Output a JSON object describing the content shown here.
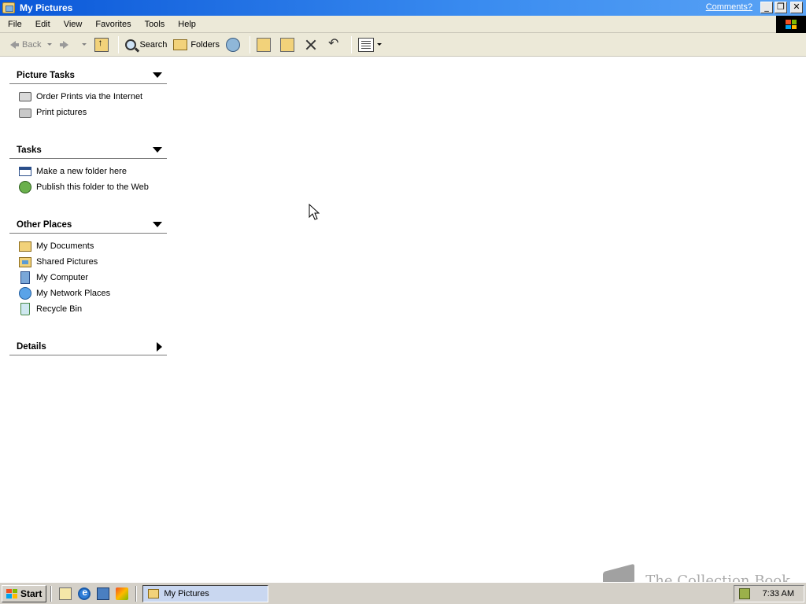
{
  "window": {
    "title": "My Pictures",
    "comments_link": "Comments?",
    "minimize": "_",
    "maximize": "❐",
    "close": "✕"
  },
  "menu": {
    "items": [
      "File",
      "Edit",
      "View",
      "Favorites",
      "Tools",
      "Help"
    ]
  },
  "toolbar": {
    "back_label": "Back",
    "search_label": "Search",
    "folders_label": "Folders"
  },
  "taskpane": {
    "picture_tasks": {
      "title": "Picture Tasks",
      "items": [
        "Order Prints via the Internet",
        "Print pictures"
      ]
    },
    "tasks": {
      "title": "Tasks",
      "items": [
        "Make a new folder here",
        "Publish this folder to the Web"
      ]
    },
    "other_places": {
      "title": "Other Places",
      "items": [
        "My Documents",
        "Shared Pictures",
        "My Computer",
        "My Network Places",
        "Recycle Bin"
      ]
    },
    "details": {
      "title": "Details"
    }
  },
  "watermark": {
    "text": "The Collection Book"
  },
  "taskbar": {
    "start_label": "Start",
    "task_label": "My Pictures",
    "clock": "7:33 AM"
  }
}
